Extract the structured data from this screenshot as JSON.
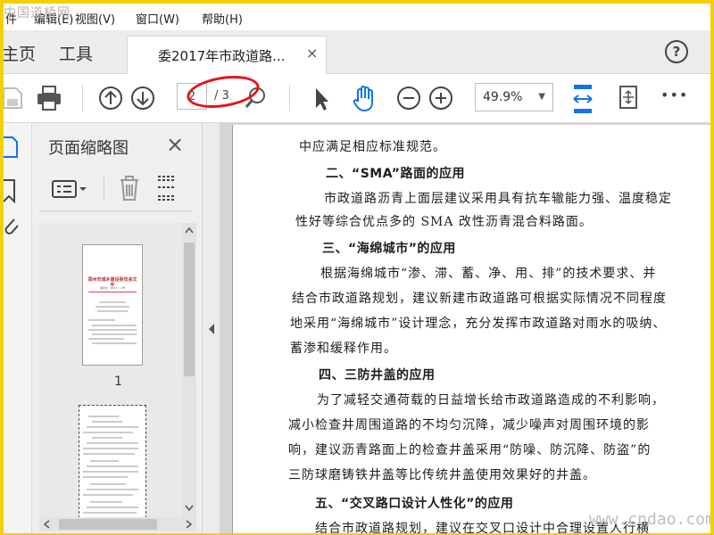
{
  "watermark_top": "中国道桥网",
  "menu": [
    "件",
    "编辑(E)",
    "视图(V)",
    "窗口(W)",
    "帮助(H)"
  ],
  "tabs": {
    "home": "主页",
    "tools": "工具",
    "doc": "委2017年市政道路...",
    "close": "×",
    "help": "?"
  },
  "toolbar": {
    "page_current": "2",
    "page_total": "/ 3",
    "zoom": "49.9%",
    "zoom_caret": "▼",
    "more": "•••"
  },
  "panel": {
    "title": "页面缩略图",
    "close": "×",
    "thumb1_num": "1"
  },
  "thumb1": {
    "header": "郑州市城乡建设委员会文件",
    "ref": "郑建文〔2017〕×号"
  },
  "doc": {
    "lines": [
      "中应满足相应标准规范。",
      "二、“SMA”路面的应用",
      "市政道路沥青上面层建议采用具有抗车辙能力强、温度稳定",
      "性好等综合优点多的 SMA 改性沥青混合料路面。",
      "三、“海绵城市”的应用",
      "根据海绵城市“渗、滞、蓄、净、用、排”的技术要求、并",
      "结合市政道路规划，建议新建市政道路可根据实际情况不同程度",
      "地采用“海绵城市”设计理念，充分发挥市政道路对雨水的吸纳、",
      "蓄渗和缓释作用。",
      "四、三防井盖的应用",
      "为了减轻交通荷载的日益增长给市政道路造成的不利影响，",
      "减小检查井周围道路的不均匀沉降，减少噪声对周围环境的影",
      "响，建议沥青路面上的检查井盖采用“防噪、防沉降、防盗”的",
      "三防球磨铸铁井盖等比传统井盖使用效果好的井盖。",
      "五、“交叉路口设计人性化”的应用",
      "结合市政道路规划，建议在交叉口设计中合理设置人行横"
    ]
  },
  "watermark_bottom": "www.cndao.com",
  "colors": {
    "frame": "#f5d000",
    "annotation": "#e2141a",
    "accent": "#1473e6"
  }
}
